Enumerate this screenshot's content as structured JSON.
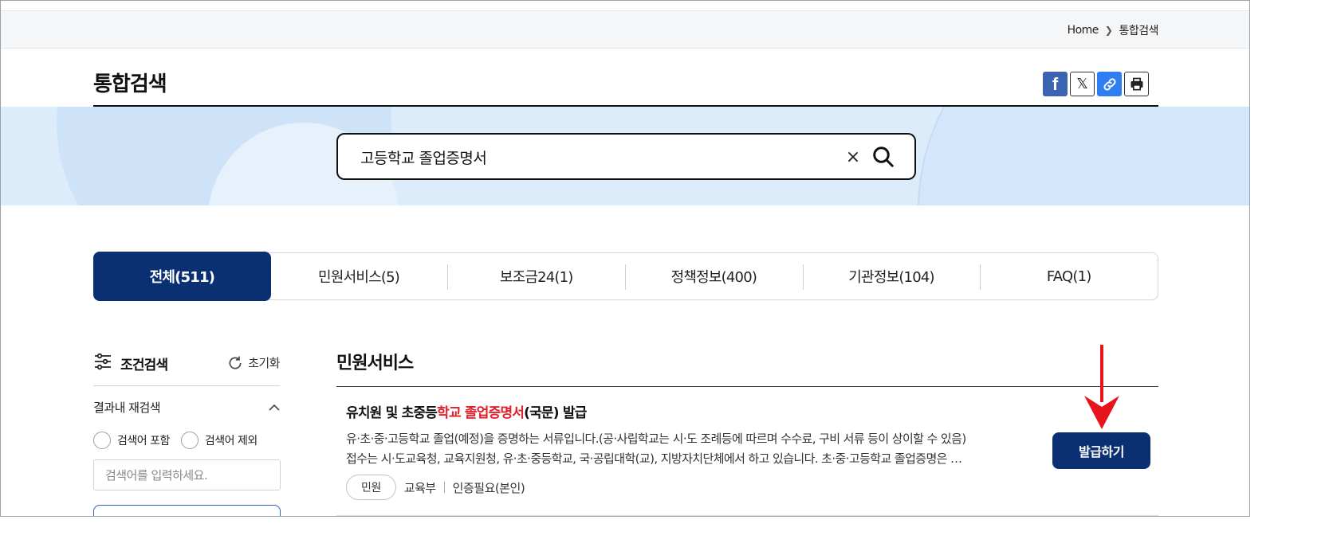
{
  "breadcrumb": {
    "home": "Home",
    "current": "통합검색"
  },
  "page": {
    "title": "통합검색"
  },
  "share": {
    "facebook_glyph": "f",
    "x_glyph": "𝕏"
  },
  "search": {
    "query": "고등학교 졸업증명서",
    "clear_glyph": "×"
  },
  "tabs": [
    {
      "label": "전체(511)",
      "active": true
    },
    {
      "label": "민원서비스(5)"
    },
    {
      "label": "보조금24(1)"
    },
    {
      "label": "정책정보(400)"
    },
    {
      "label": "기관정보(104)"
    },
    {
      "label": "FAQ(1)"
    }
  ],
  "filter": {
    "title": "조건검색",
    "reset_label": "초기화",
    "refine_title": "결과내 재검색",
    "include_label": "검색어 포함",
    "exclude_label": "검색어 제외",
    "refine_placeholder": "검색어를 입력하세요."
  },
  "section": {
    "title": "민원서비스"
  },
  "result": {
    "title_before": "유치원 및 초중등",
    "title_highlight": "학교 졸업증명서",
    "title_after": "(국문) 발급",
    "desc_line1": "유·초·중·고등학교 졸업(예정)을 증명하는 서류입니다.(공·사립학교는 시·도 조례등에 따르며 수수료, 구비 서류 등이 상이할 수 있음)",
    "desc_line2": "접수는 시·도교육청, 교육지원청, 유·초·중등학교, 국·공립대학(교), 지방자치단체에서 하고 있습니다. 초·중·고등학교 졸업증명은 …",
    "tag": "민원",
    "agency": "교육부",
    "auth": "인증필요(본인)",
    "issue_label": "발급하기"
  },
  "colors": {
    "navy": "#0a2f73",
    "highlight": "#e2202a",
    "banner": "#ddecfb",
    "annotation_arrow": "#e8141c"
  }
}
